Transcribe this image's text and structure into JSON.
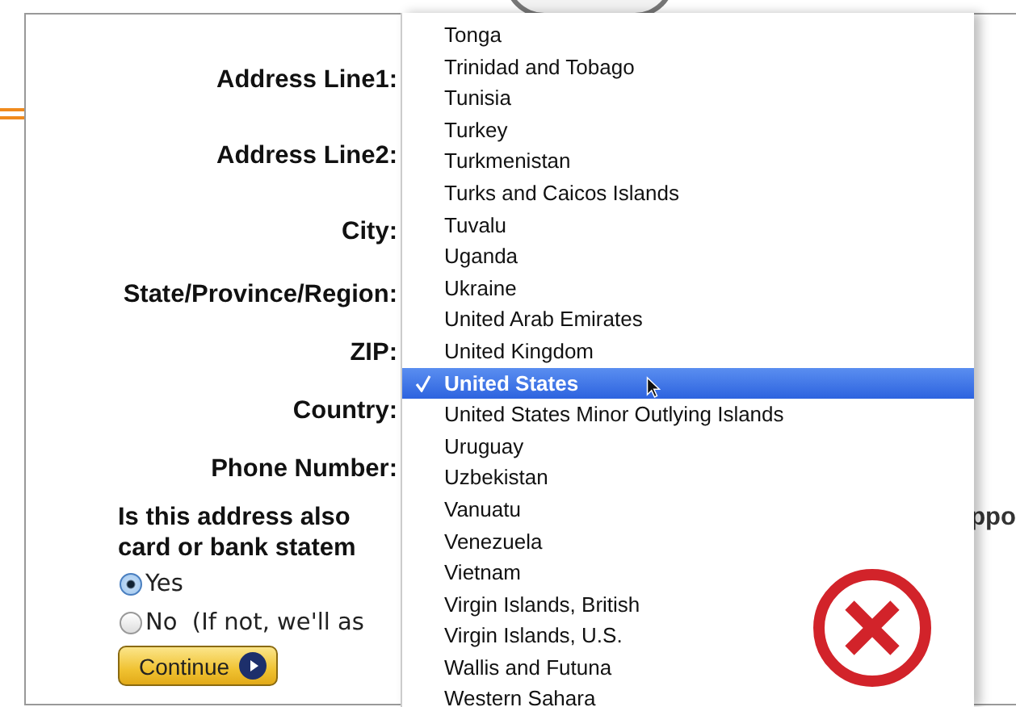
{
  "form": {
    "fields": [
      {
        "label": "Address Line1:"
      },
      {
        "label": "Address Line2:"
      },
      {
        "label": "City:"
      },
      {
        "label": "State/Province/Region:"
      },
      {
        "label": "ZIP:"
      },
      {
        "label": "Country:"
      },
      {
        "label": "Phone Number:"
      }
    ],
    "question": [
      "Is this address also",
      "card or bank statem"
    ],
    "question_fragment": "ppo",
    "options": [
      {
        "label": "Yes",
        "selected": true
      },
      {
        "label": "No  (If not, we'll as",
        "selected": false
      }
    ],
    "button": "Continue"
  },
  "country_menu": {
    "items": [
      {
        "label": "Tonga",
        "selected": false
      },
      {
        "label": "Trinidad and Tobago",
        "selected": false
      },
      {
        "label": "Tunisia",
        "selected": false
      },
      {
        "label": "Turkey",
        "selected": false
      },
      {
        "label": "Turkmenistan",
        "selected": false
      },
      {
        "label": "Turks and Caicos Islands",
        "selected": false
      },
      {
        "label": "Tuvalu",
        "selected": false
      },
      {
        "label": "Uganda",
        "selected": false
      },
      {
        "label": "Ukraine",
        "selected": false
      },
      {
        "label": "United Arab Emirates",
        "selected": false
      },
      {
        "label": "United Kingdom",
        "selected": false
      },
      {
        "label": "United States",
        "selected": true
      },
      {
        "label": "United States Minor Outlying Islands",
        "selected": false
      },
      {
        "label": "Uruguay",
        "selected": false
      },
      {
        "label": "Uzbekistan",
        "selected": false
      },
      {
        "label": "Vanuatu",
        "selected": false
      },
      {
        "label": "Venezuela",
        "selected": false
      },
      {
        "label": "Vietnam",
        "selected": false
      },
      {
        "label": "Virgin Islands, British",
        "selected": false
      },
      {
        "label": "Virgin Islands, U.S.",
        "selected": false
      },
      {
        "label": "Wallis and Futuna",
        "selected": false
      },
      {
        "label": "Western Sahara",
        "selected": false
      }
    ]
  }
}
